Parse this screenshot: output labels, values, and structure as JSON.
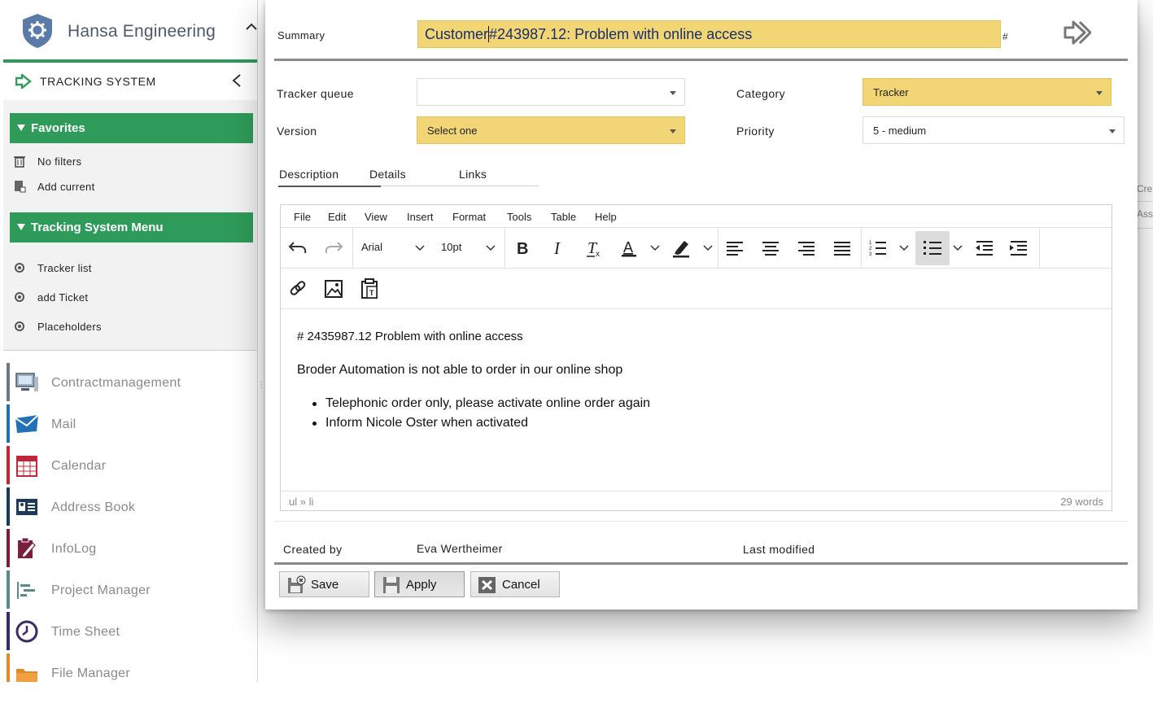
{
  "sidebar": {
    "brand": "Hansa Engineering",
    "section_title": "TRACKING SYSTEM",
    "favorites": {
      "title": "Favorites",
      "items": [
        {
          "label": "No filters",
          "icon": "trash-icon"
        },
        {
          "label": "Add current",
          "icon": "add-filter-icon"
        }
      ]
    },
    "menu": {
      "title": "Tracking System Menu",
      "items": [
        {
          "label": "Tracker list",
          "icon": "bullet-icon"
        },
        {
          "label": "add Ticket",
          "icon": "bullet-icon"
        },
        {
          "label": "Placeholders",
          "icon": "bullet-icon"
        }
      ]
    },
    "apps": [
      {
        "label": "Contractmanagement",
        "icon": "computer-icon",
        "color": "#6b7a88"
      },
      {
        "label": "Mail",
        "icon": "envelope-icon",
        "color": "#2270b6"
      },
      {
        "label": "Calendar",
        "icon": "calendar-icon",
        "color": "#c0283a"
      },
      {
        "label": "Address Book",
        "icon": "contact-card-icon",
        "color": "#1b3a5c"
      },
      {
        "label": "InfoLog",
        "icon": "clipboard-pen-icon",
        "color": "#7a1f3b"
      },
      {
        "label": "Project Manager",
        "icon": "gantt-icon",
        "color": "#5a8a8a"
      },
      {
        "label": "Time Sheet",
        "icon": "clock-icon",
        "color": "#3a2a6a"
      },
      {
        "label": "File Manager",
        "icon": "folder-icon",
        "color": "#e08a2a"
      }
    ]
  },
  "dialog": {
    "summary_label": "Summary",
    "summary_value_before_caret": "Customer",
    "summary_value_after_caret": "#243987.12: Problem with online access",
    "hash": "#",
    "fields": {
      "tracker_queue": {
        "label": "Tracker queue",
        "value": ""
      },
      "version": {
        "label": "Version",
        "value": "Select one"
      },
      "category": {
        "label": "Category",
        "value": "Tracker"
      },
      "priority": {
        "label": "Priority",
        "value": "5 - medium"
      }
    },
    "tabs": [
      "Description",
      "Details",
      "Links"
    ],
    "editor": {
      "menu": [
        "File",
        "Edit",
        "View",
        "Insert",
        "Format",
        "Tools",
        "Table",
        "Help"
      ],
      "font": "Arial",
      "size": "10pt",
      "content": {
        "line1": "# 2435987.12 Problem with online access",
        "line2": "Broder Automation is not able to order in our online shop",
        "bullets": [
          "Telephonic order only, please activate online order again",
          "Inform Nicole Oster when activated"
        ]
      },
      "path": "ul » li",
      "word_count": "29 words"
    },
    "created_by_label": "Created by",
    "created_by_value": "Eva Wertheimer",
    "last_modified_label": "Last modified",
    "buttons": {
      "save": "Save",
      "apply": "Apply",
      "cancel": "Cancel"
    }
  },
  "background_peek": {
    "line1": "Cre",
    "line2": "Ass"
  },
  "colors": {
    "accent_green": "#2f9b5a",
    "highlight_yellow": "#f2d675"
  }
}
